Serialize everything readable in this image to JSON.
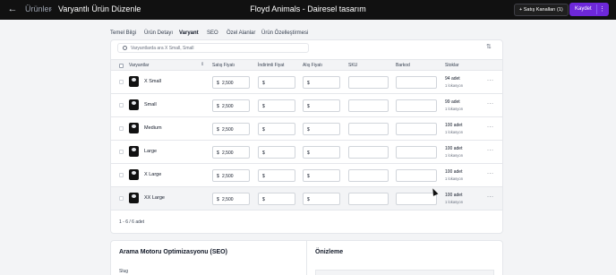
{
  "header": {
    "back_icon": "arrow-left-icon",
    "breadcrumb_link": "Ürünler",
    "breadcrumb_separator": "›",
    "page_title": "Varyantlı Ürün Düzenle",
    "product_title": "Floyd Animals - Dairesel tasarım",
    "channels_button": "+ Satış Kanalları (1)",
    "save_button": "Kaydet",
    "more_icon": "⋮"
  },
  "tabs": [
    {
      "label": "Temel Bilgi"
    },
    {
      "label": "Ürün Detayı"
    },
    {
      "label": "Varyant"
    },
    {
      "label": "SEO"
    },
    {
      "label": "Özel Alanlar"
    },
    {
      "label": "Ürün Özelleştirmesi"
    }
  ],
  "active_tab": "Varyant",
  "search": {
    "placeholder": "Varyantlarda ara X Small, Small"
  },
  "table": {
    "columns": [
      "Varyantlar",
      "Satış Fiyatı",
      "İndirimli Fiyat",
      "Alış Fiyatı",
      "SKU",
      "Barkod",
      "Stoklar"
    ],
    "currency": "$",
    "rows": [
      {
        "name": "X Small",
        "price": "2,500",
        "stock": "94 adet",
        "locations": "1 lokasyon"
      },
      {
        "name": "Small",
        "price": "2,500",
        "stock": "99 adet",
        "locations": "1 lokasyon"
      },
      {
        "name": "Medium",
        "price": "2,500",
        "stock": "100 adet",
        "locations": "1 lokasyon"
      },
      {
        "name": "Large",
        "price": "2,500",
        "stock": "100 adet",
        "locations": "1 lokasyon"
      },
      {
        "name": "X Large",
        "price": "2,500",
        "stock": "100 adet",
        "locations": "1 lokasyon"
      },
      {
        "name": "XX Large",
        "price": "2,500",
        "stock": "100 adet",
        "locations": "1 lokasyon"
      }
    ],
    "row_actions": "···",
    "count_text": "1 - 6 / 6 adet"
  },
  "seo": {
    "title": "Arama Motoru Optimizasyonu (SEO)",
    "slug_label": "Slug"
  },
  "preview": {
    "title": "Önizleme"
  },
  "colors": {
    "accent": "#6d28d9",
    "topbar": "#111111",
    "page_bg": "#f3f4f6"
  }
}
